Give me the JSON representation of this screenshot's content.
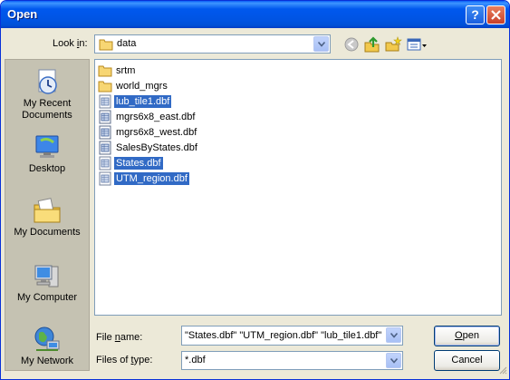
{
  "window": {
    "title": "Open"
  },
  "look_in": {
    "label_pre": "Look ",
    "label_key": "i",
    "label_post": "n:",
    "value": "data"
  },
  "toolbar": {
    "back_icon": "back-icon",
    "up_icon": "up-folder-icon",
    "new_folder_icon": "new-folder-icon",
    "views_icon": "views-menu-icon"
  },
  "places": [
    {
      "label": "My Recent Documents",
      "icon": "recent-documents-icon"
    },
    {
      "label": "Desktop",
      "icon": "desktop-icon"
    },
    {
      "label": "My Documents",
      "icon": "my-documents-icon"
    },
    {
      "label": "My Computer",
      "icon": "my-computer-icon"
    },
    {
      "label": "My Network",
      "icon": "my-network-icon"
    }
  ],
  "files": [
    {
      "name": "srtm",
      "type": "folder",
      "selected": false
    },
    {
      "name": "world_mgrs",
      "type": "folder",
      "selected": false
    },
    {
      "name": "lub_tile1.dbf",
      "type": "dbf",
      "selected": true
    },
    {
      "name": "mgrs6x8_east.dbf",
      "type": "dbf",
      "selected": false
    },
    {
      "name": "mgrs6x8_west.dbf",
      "type": "dbf",
      "selected": false
    },
    {
      "name": "SalesByStates.dbf",
      "type": "dbf",
      "selected": false
    },
    {
      "name": "States.dbf",
      "type": "dbf",
      "selected": true
    },
    {
      "name": "UTM_region.dbf",
      "type": "dbf",
      "selected": true
    }
  ],
  "file_name": {
    "label_pre": "File ",
    "label_key": "n",
    "label_post": "ame:",
    "value": "\"States.dbf\" \"UTM_region.dbf\" \"lub_tile1.dbf\""
  },
  "files_of_type": {
    "label_pre": "Files of ",
    "label_key": "t",
    "label_post": "ype:",
    "value": "*.dbf"
  },
  "buttons": {
    "open_key": "O",
    "open_rest": "pen",
    "cancel": "Cancel"
  },
  "colors": {
    "title_bar": "#0054e3",
    "selection": "#316ac5",
    "dialog_bg": "#ece9d8"
  }
}
